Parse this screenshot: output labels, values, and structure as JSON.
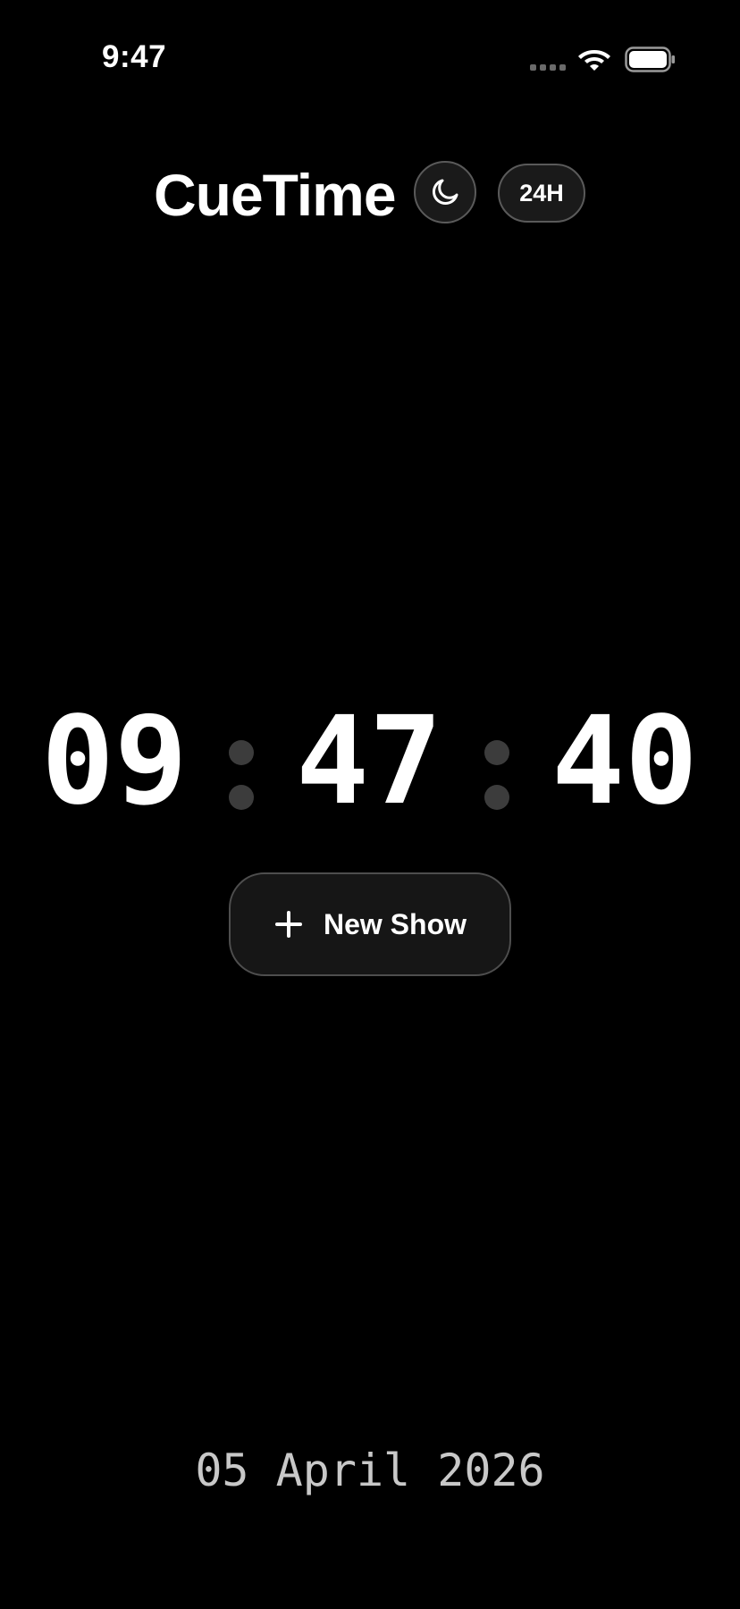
{
  "status_bar": {
    "time": "9:47",
    "icons": [
      "signal-dots-icon",
      "wifi-icon",
      "battery-icon"
    ]
  },
  "header": {
    "title": "CueTime",
    "theme_icon": "moon-icon",
    "format_label": "24H"
  },
  "clock": {
    "hours": "09",
    "minutes": "47",
    "seconds": "40"
  },
  "actions": {
    "new_show_icon": "plus-icon",
    "new_show_label": "New Show"
  },
  "footer": {
    "date": "05 April 2026"
  },
  "colors": {
    "background": "#000000",
    "text": "#ffffff",
    "muted_text": "#c8c8c8",
    "separator": "#3c3c3c",
    "button_bg": "#161616",
    "button_border": "#4e4e4e"
  }
}
